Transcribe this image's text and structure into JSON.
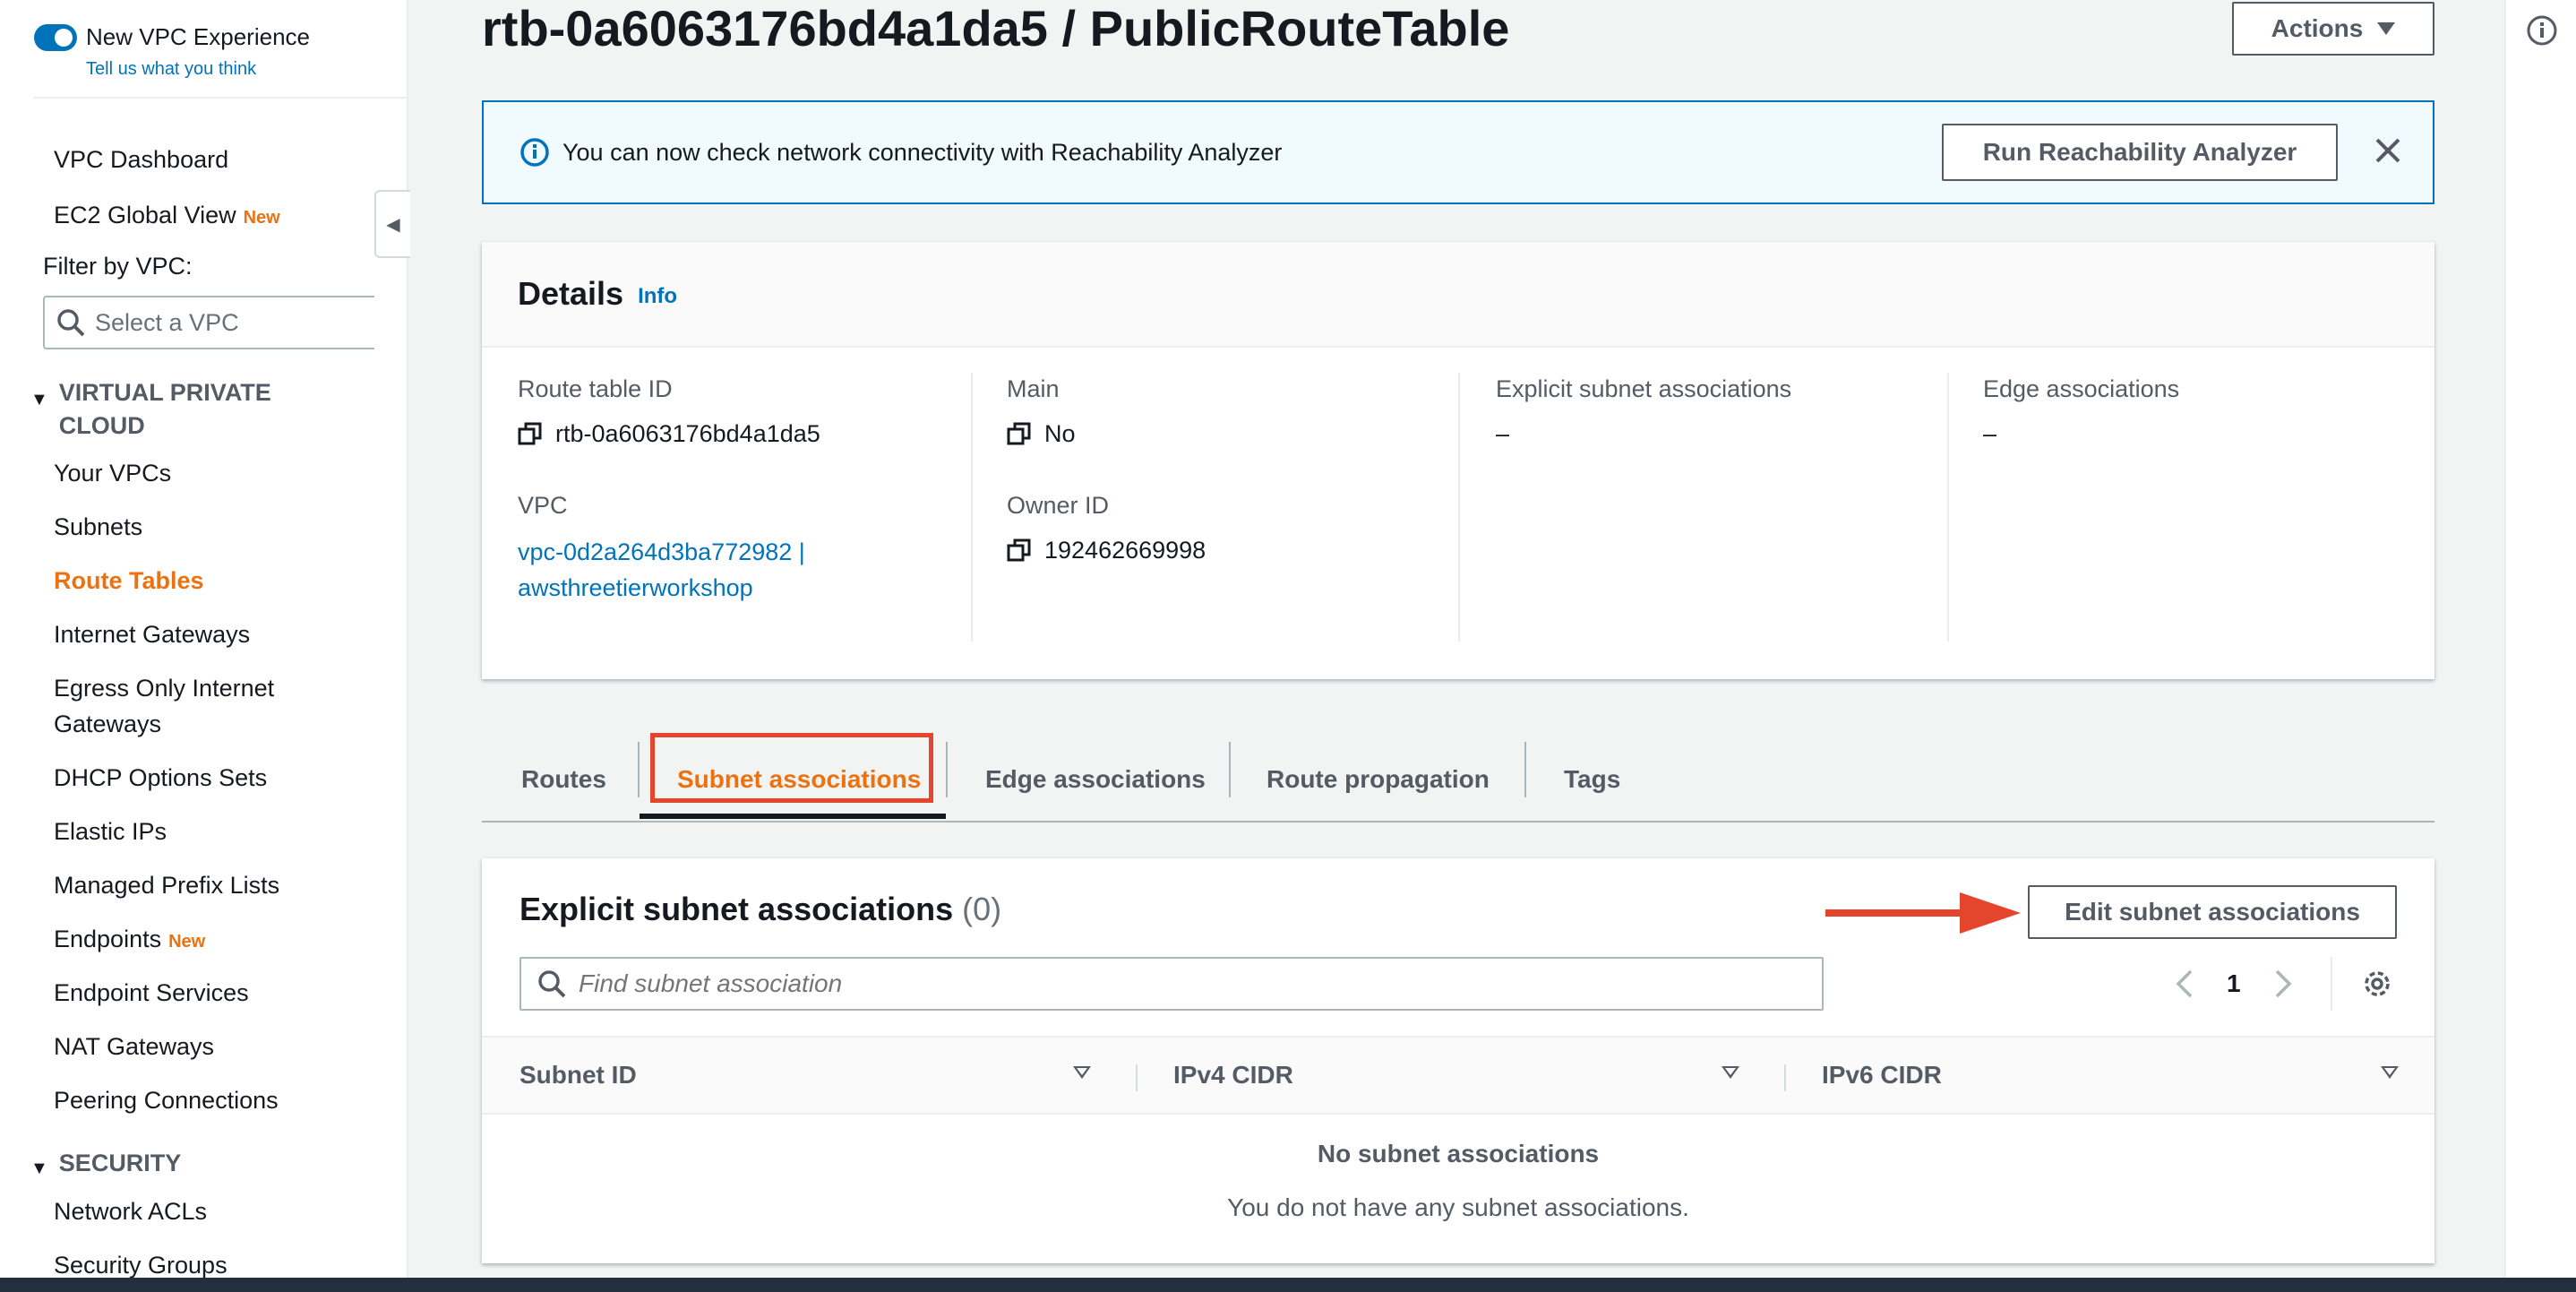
{
  "sidebar": {
    "toggle_label": "New VPC Experience",
    "toggle_sub": "Tell us what you think",
    "items_top": [
      {
        "label": "VPC Dashboard",
        "badge": ""
      },
      {
        "label": "EC2 Global View",
        "badge": "New"
      }
    ],
    "filter_label": "Filter by VPC:",
    "filter_placeholder": "Select a VPC",
    "section_vpc": "VIRTUAL PRIVATE CLOUD",
    "section_vpc_line1": "VIRTUAL PRIVATE",
    "section_vpc_line2": "CLOUD",
    "vpc_items": [
      {
        "label": "Your VPCs"
      },
      {
        "label": "Subnets"
      },
      {
        "label": "Route Tables",
        "active": true
      },
      {
        "label": "Internet Gateways"
      },
      {
        "label_line1": "Egress Only Internet",
        "label_line2": "Gateways"
      },
      {
        "label": "DHCP Options Sets"
      },
      {
        "label": "Elastic IPs"
      },
      {
        "label": "Managed Prefix Lists"
      },
      {
        "label": "Endpoints",
        "badge": "New"
      },
      {
        "label": "Endpoint Services"
      },
      {
        "label": "NAT Gateways"
      },
      {
        "label": "Peering Connections"
      }
    ],
    "section_security": "SECURITY",
    "security_items": [
      {
        "label": "Network ACLs"
      },
      {
        "label": "Security Groups"
      }
    ]
  },
  "header": {
    "title": "rtb-0a6063176bd4a1da5 / PublicRouteTable",
    "actions_label": "Actions"
  },
  "flash": {
    "message": "You can now check network connectivity with Reachability Analyzer",
    "button_label": "Run Reachability Analyzer"
  },
  "details": {
    "title": "Details",
    "info": "Info",
    "route_table_id_label": "Route table ID",
    "route_table_id": "rtb-0a6063176bd4a1da5",
    "vpc_label": "VPC",
    "vpc_line1": "vpc-0d2a264d3ba772982 |",
    "vpc_line2": "awsthreetierworkshop",
    "main_label": "Main",
    "main_value": "No",
    "owner_label": "Owner ID",
    "owner_value": "192462669998",
    "explicit_label": "Explicit subnet associations",
    "explicit_value": "–",
    "edge_label": "Edge associations",
    "edge_value": "–"
  },
  "tabs": [
    {
      "label": "Routes"
    },
    {
      "label": "Subnet associations",
      "active": true
    },
    {
      "label": "Edge associations"
    },
    {
      "label": "Route propagation"
    },
    {
      "label": "Tags"
    }
  ],
  "associations": {
    "title": "Explicit subnet associations",
    "count": "(0)",
    "edit_button": "Edit subnet associations",
    "search_placeholder": "Find subnet association",
    "page": "1",
    "columns": [
      "Subnet ID",
      "IPv4 CIDR",
      "IPv6 CIDR"
    ],
    "empty_title": "No subnet associations",
    "empty_sub": "You do not have any subnet associations."
  },
  "colors": {
    "accent": "#ec7211",
    "link": "#0073bb",
    "highlight": "#e5442d"
  }
}
